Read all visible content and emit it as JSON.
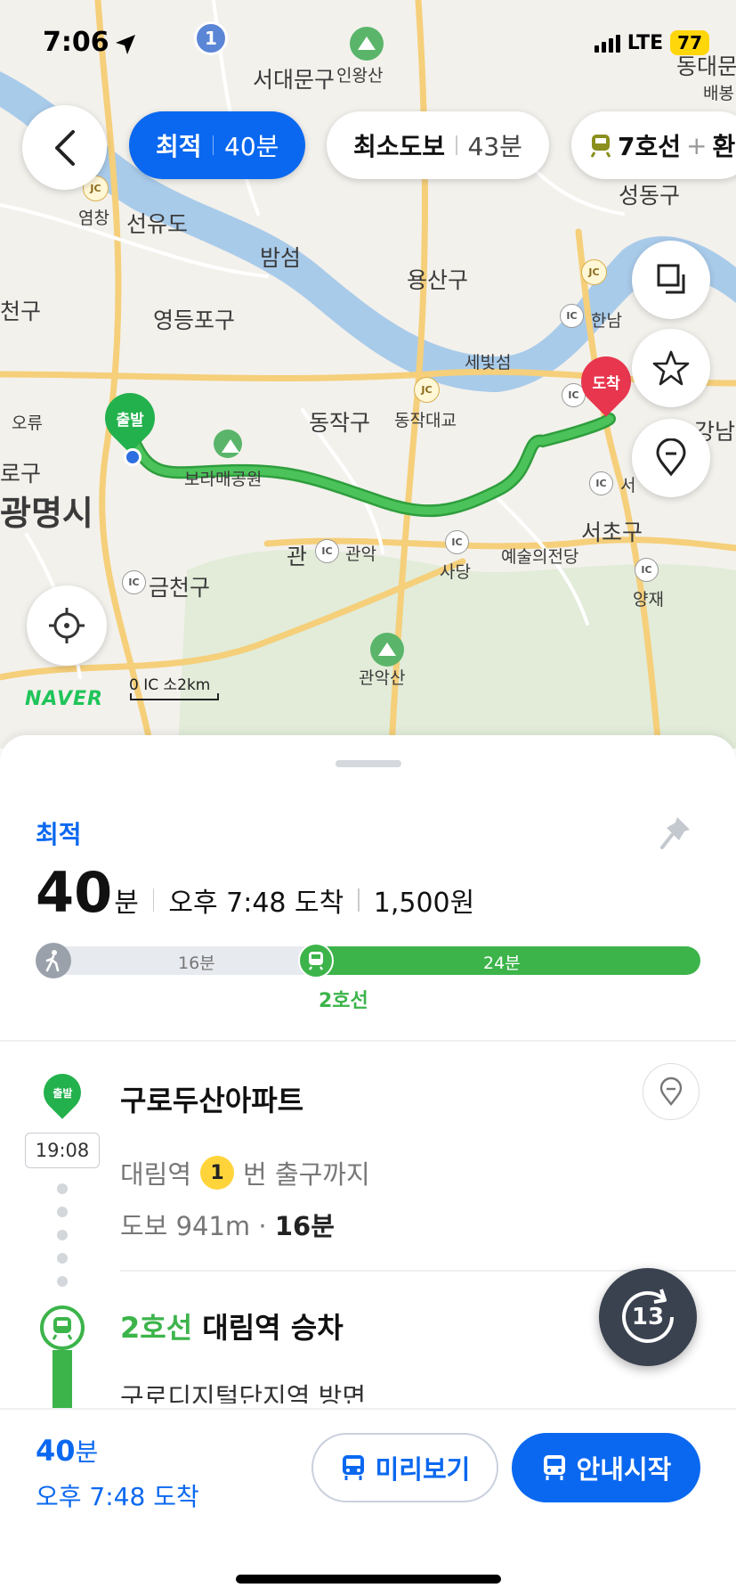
{
  "status_bar": {
    "time": "7:06",
    "network": "LTE",
    "battery": "77"
  },
  "route_chips": [
    {
      "name": "최적",
      "time": "40분"
    },
    {
      "name": "최소도보",
      "time": "43분"
    },
    {
      "name": "7호선",
      "plus": "+",
      "suffix": "환"
    }
  ],
  "map": {
    "labels": {
      "seodaemun": "서대문구",
      "inwangsan": "인왕산",
      "seongdong": "성동구",
      "dongdaemun": "동대문",
      "baebong": "배봉",
      "yeomchang": "염창",
      "seonyudo": "선유도",
      "bamseom": "밤섬",
      "yongsan": "용산구",
      "dong": "동",
      "yangcheon": "천구",
      "yeongdeungpo": "영등포구",
      "hannam": "한남",
      "sebitseom": "세빛섬",
      "ori": "오류",
      "gu": "로구",
      "gwangmyeong": "광명시",
      "dongjak": "동작구",
      "dongjak_bridge": "동작대교",
      "gangnam": "강남",
      "boramae": "보라매공원",
      "seo": "서",
      "seocho": "서초구",
      "gwanak_ic": "관",
      "gwanak": "관악",
      "sadang": "사당",
      "arts_center": "예술의전당",
      "yangjae": "양재",
      "geumcheon": "금천구",
      "gwanaksan": "관악산",
      "start_pin": "출발",
      "end_pin": "도착",
      "naver": "NAVER",
      "scale": "0  IC  소2km",
      "ic": "IC",
      "jc": "JC",
      "route_badge": "1"
    }
  },
  "summary": {
    "type": "최적",
    "minutes": "40",
    "minutes_unit": "분",
    "arrival": "오후 7:48 도착",
    "fare": "1,500원",
    "walk_label": "16분",
    "ride_label": "24분",
    "walk_fraction": 0.4,
    "line": "2호선"
  },
  "steps": {
    "start_pin": "출발",
    "start_time": "19:08",
    "start_name": "구로두산아파트",
    "exit_prefix": "대림역",
    "exit_number": "1",
    "exit_suffix": "번 출구까지",
    "walk_prefix": "도보 941m ·",
    "walk_time": "16분",
    "board_line": "2호선",
    "board_station": "대림역 승차",
    "next_direction": "구로디지털단지역 방면",
    "refresh_count": "13"
  },
  "bottom_bar": {
    "minutes": "40",
    "minutes_unit": "분",
    "arrival": "오후 7:48 도착",
    "preview_label": "미리보기",
    "start_label": "안내시작"
  },
  "colors": {
    "accent": "#0a68f0",
    "subway_line2": "#3cb44a",
    "route": "#3cb44a",
    "end_pin": "#e8364f"
  }
}
